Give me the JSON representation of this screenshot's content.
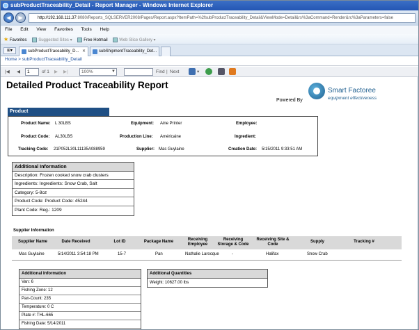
{
  "window": {
    "title": "subProductTraceability_Detail - Report Manager - Windows Internet Explorer"
  },
  "address": {
    "host": "http://192.168.111.37",
    "path": ":8080/Reports_SQLSERVER2008/Pages/Report.aspx?ItemPath=%2fsubProductTraceability_Detail&ViewMode=Detail&rs%3aCommand=Render&rc%3aParameters=false"
  },
  "menu": [
    "File",
    "Edit",
    "View",
    "Favorites",
    "Tools",
    "Help"
  ],
  "favorites": {
    "label": "Favorites",
    "items": [
      "Suggested Sites ▾",
      "Free Hotmail",
      "Web Slice Gallery ▾"
    ]
  },
  "tabs": [
    {
      "label": "subProductTraceability_D...",
      "close": "✕"
    },
    {
      "label": "subShipmentTraceability_Det..."
    }
  ],
  "breadcrumb": "Home > subProductTraceability_Detail",
  "toolbar": {
    "first": "|◀",
    "prev": "◀",
    "page": "1",
    "of": "of 1",
    "next": "▶",
    "last": "▶|",
    "zoom": "100%",
    "find": "Find",
    "sep": "|",
    "next_label": "Next"
  },
  "report": {
    "title": "Detailed Product Traceability Report",
    "powered_by": "Powered By",
    "logo_name": "Smart Factoree",
    "logo_tag": "equipment effectiveness",
    "product_section": "Product",
    "product": {
      "name_label": "Product Name:",
      "name": "L 30LBS",
      "equipment_label": "Equipment:",
      "equipment": "Aine Printer",
      "employee_label": "Employee:",
      "employee": "",
      "code_label": "Product Code:",
      "code": "AL30LBS",
      "line_label": "Production Line:",
      "line": "Américaine",
      "ingredient_label": "Ingredient:",
      "ingredient": "",
      "tracking_label": "Tracking Code:",
      "tracking": "21P052L30L11135A088959",
      "supplier_label": "Supplier:",
      "supplier": "Mas Guylaine",
      "created_label": "Creation Date:",
      "created": "5/15/2011 9:33:51 AM"
    },
    "additional_info": {
      "header": "Additional Information",
      "rows": [
        "Description: Frozen cooked snow crab clusters",
        "Ingredients: Ingredients: Snow Crab, Salt",
        "Category: 5-8oz",
        "Product Code: Product Code: 45244",
        "Plant Code: Reg.: 1209"
      ]
    },
    "supplier_info": {
      "title": "Supplier Information",
      "columns": [
        "Supplier Name",
        "Date Received",
        "Lot ID",
        "Package Name",
        "Receiving Employee",
        "Receiving Storage & Code",
        "Receiving Site & Code",
        "Supply",
        "Tracking #"
      ],
      "row": [
        "Mas Guylaine",
        "5/14/2011 3:54:18 PM",
        "15-7",
        "Pan",
        "Nathalie Larocque",
        "-",
        "Halifax",
        "Snow Crab",
        ""
      ]
    },
    "supplier_additional": {
      "header": "Additional Information",
      "rows": [
        "Van: 6",
        "Fishing Zone: 12",
        "Pan-Count: 235",
        "Temperature: 0 C",
        "Plate #: THL-665",
        "Fishing Date: 5/14/2011"
      ]
    },
    "quantities": {
      "header": "Additional Quantities",
      "row": "Weight: 10627.00 lbs"
    }
  }
}
